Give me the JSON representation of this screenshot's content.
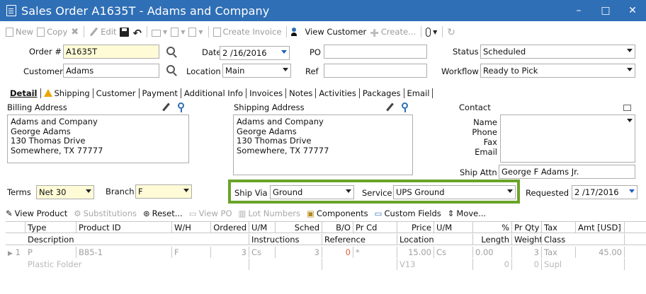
{
  "window": {
    "title": "Sales Order A1635T - Adams and Company",
    "controls": [
      "–",
      "□",
      "✕"
    ]
  },
  "toolbar": {
    "new": "New",
    "copy": "Copy",
    "edit": "Edit",
    "create_invoice": "Create Invoice",
    "view_customer": "View Customer",
    "create": "Create..."
  },
  "header": {
    "order_label": "Order #",
    "order_value": "A1635T",
    "date_label": "Date",
    "date_value": "2 /16/2016",
    "po_label": "PO",
    "po_value": "",
    "status_label": "Status",
    "status_value": "Scheduled",
    "customer_label": "Customer",
    "customer_value": "Adams",
    "location_label": "Location",
    "location_value": "Main",
    "ref_label": "Ref",
    "ref_value": "",
    "workflow_label": "Workflow",
    "workflow_value": "Ready to Pick"
  },
  "tabs": [
    "Detail",
    "Shipping",
    "Customer",
    "Payment",
    "Additional Info",
    "Invoices",
    "Notes",
    "Activities",
    "Packages",
    "Email"
  ],
  "detail": {
    "billing_label": "Billing Address",
    "billing_lines": [
      "Adams and Company",
      "George Adams",
      "130 Thomas Drive",
      "Somewhere, TX 77777"
    ],
    "shipping_label": "Shipping Address",
    "shipping_lines": [
      "Adams and Company",
      "George Adams",
      "130 Thomas Drive",
      "Somewhere, TX 77777"
    ],
    "contact_label": "Contact",
    "contact_fields": [
      "Name",
      "Phone",
      "Fax",
      "Email"
    ],
    "ship_attn_label": "Ship Attn",
    "ship_attn_value": "George F Adams Jr.",
    "terms_label": "Terms",
    "terms_value": "Net 30",
    "branch_label": "Branch",
    "branch_value": "F",
    "ship_via_label": "Ship Via",
    "ship_via_value": "Ground",
    "service_label": "Service",
    "service_value": "UPS Ground",
    "requested_label": "Requested",
    "requested_value": "2 /17/2016"
  },
  "item_toolbar": {
    "view_product": "View Product",
    "substitutions": "Substitutions",
    "reset": "Reset...",
    "view_po": "View PO",
    "lot_numbers": "Lot Numbers",
    "components": "Components",
    "custom_fields": "Custom Fields",
    "move": "Move..."
  },
  "grid": {
    "header1": [
      "",
      "Type",
      "Product ID",
      "W/H",
      "Ordered",
      "U/M",
      "Sched",
      "B/O",
      "Pr Cd",
      "Price",
      "U/M",
      "%",
      "Pr Qty",
      "Tax",
      "Amt [USD]"
    ],
    "header2": [
      "",
      "Description",
      "Instructions",
      "Reference",
      "Location",
      "Length",
      "Weight",
      "Class"
    ],
    "row1": [
      "1",
      "P",
      "B85-1",
      "F",
      "3",
      "Cs",
      "3",
      "0",
      "*",
      "15.00",
      "Cs",
      "0.00",
      "3",
      "Tax",
      "45.00"
    ],
    "row2": [
      "Plastic Folder",
      "",
      "",
      "V13",
      "0",
      "0",
      "Supl"
    ]
  }
}
